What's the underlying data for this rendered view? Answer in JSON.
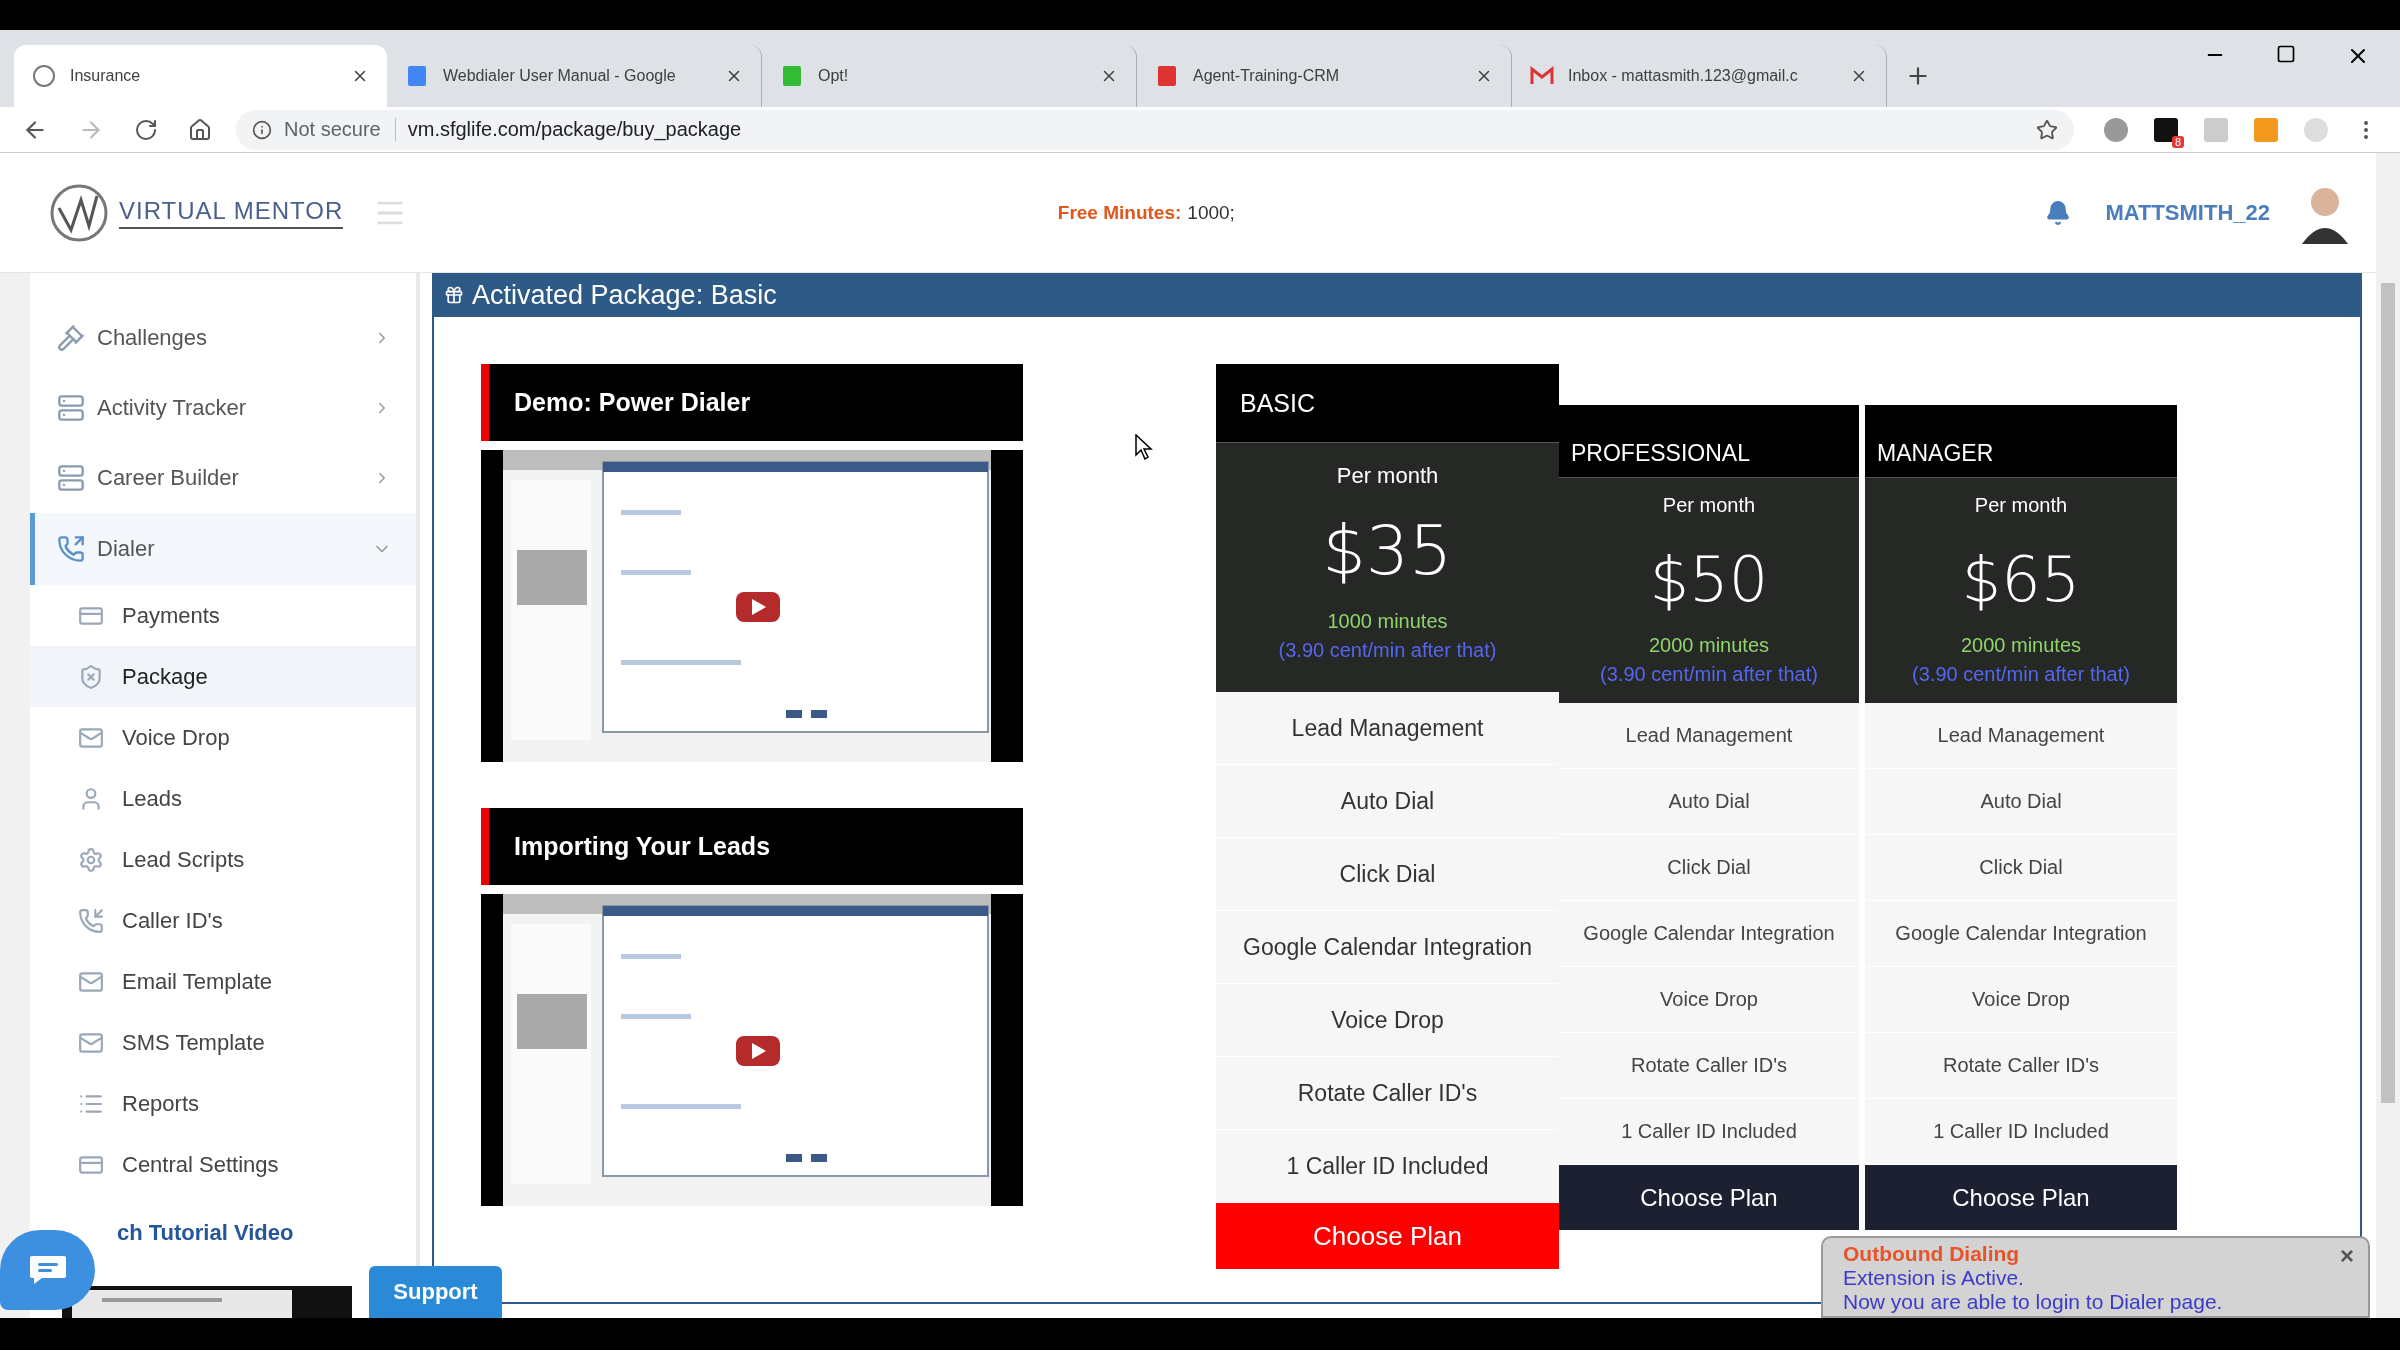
{
  "browser": {
    "tabs": [
      {
        "title": "Insurance",
        "selected": true
      },
      {
        "title": "Webdialer User Manual - Google",
        "selected": false
      },
      {
        "title": "Opt!",
        "selected": false
      },
      {
        "title": "Agent-Training-CRM",
        "selected": false
      },
      {
        "title": "Inbox - mattasmith.123@gmail.c",
        "selected": false
      }
    ],
    "security": "Not secure",
    "url": "vm.sfglife.com/package/buy_package",
    "extension_badge": "8"
  },
  "header": {
    "logo": "VIRTUAL MENTOR",
    "free_minutes_label": "Free Minutes:",
    "free_minutes_value": "1000;",
    "username": "MATTSMITH_22"
  },
  "sidebar": {
    "items": [
      {
        "label": "Challenges",
        "expanded": false,
        "selected": false
      },
      {
        "label": "Activity Tracker",
        "expanded": false,
        "selected": false
      },
      {
        "label": "Career Builder",
        "expanded": false,
        "selected": false
      },
      {
        "label": "Dialer",
        "expanded": true,
        "selected": true,
        "children": [
          {
            "label": "Payments",
            "selected": false
          },
          {
            "label": "Package",
            "selected": true
          },
          {
            "label": "Voice Drop",
            "selected": false
          },
          {
            "label": "Leads",
            "selected": false
          },
          {
            "label": "Lead Scripts",
            "selected": false
          },
          {
            "label": "Caller ID's",
            "selected": false
          },
          {
            "label": "Email Template",
            "selected": false
          },
          {
            "label": "SMS Template",
            "selected": false
          },
          {
            "label": "Reports",
            "selected": false
          },
          {
            "label": "Central Settings",
            "selected": false
          }
        ]
      }
    ],
    "tutorial_link": "ch Tutorial Video",
    "support_button": "Support"
  },
  "panel": {
    "title": "Activated Package: Basic",
    "videos": [
      {
        "title": "Demo: Power Dialer",
        "kind": "picture"
      },
      {
        "title": "Importing Your Leads",
        "kind": "picture"
      }
    ],
    "plans": [
      {
        "name": "BASIC",
        "selected": true,
        "period": "Per month",
        "price": "$35",
        "minutes": "1000 minutes",
        "rate": "(3.90 cent/min after that)",
        "features": [
          "Lead Management",
          "Auto Dial",
          "Click Dial",
          "Google Calendar Integration",
          "Voice Drop",
          "Rotate Caller ID's",
          "1 Caller ID Included"
        ],
        "button": "Choose Plan"
      },
      {
        "name": "PROFESSIONAL",
        "selected": false,
        "period": "Per month",
        "price": "$50",
        "minutes": "2000 minutes",
        "rate": "(3.90 cent/min after that)",
        "features": [
          "Lead Management",
          "Auto Dial",
          "Click Dial",
          "Google Calendar Integration",
          "Voice Drop",
          "Rotate Caller ID's",
          "1 Caller ID Included"
        ],
        "button": "Choose Plan"
      },
      {
        "name": "MANAGER",
        "selected": false,
        "period": "Per month",
        "price": "$65",
        "minutes": "2000 minutes",
        "rate": "(3.90 cent/min after that)",
        "features": [
          "Lead Management",
          "Auto Dial",
          "Click Dial",
          "Google Calendar Integration",
          "Voice Drop",
          "Rotate Caller ID's",
          "1 Caller ID Included"
        ],
        "button": "Choose Plan"
      }
    ]
  },
  "notification": {
    "title": "Outbound Dialing",
    "lines": [
      "Extension is Active.",
      "Now you are able to login to Dialer page."
    ],
    "close": "×"
  }
}
